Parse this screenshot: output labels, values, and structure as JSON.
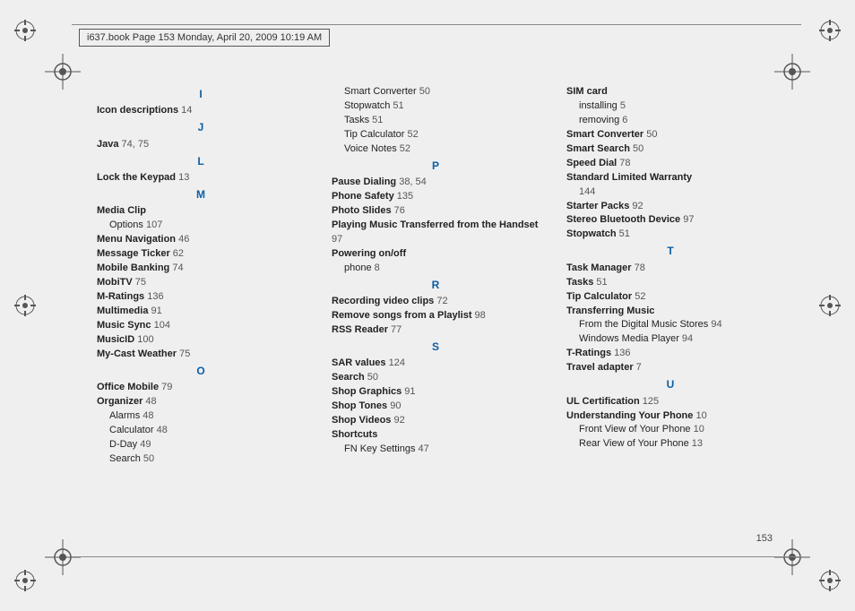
{
  "header": "i637.book  Page 153  Monday, April 20, 2009  10:19 AM",
  "page_number": "153",
  "columns": [
    {
      "items": [
        {
          "type": "letter",
          "text": "I"
        },
        {
          "type": "entry",
          "bold": "Icon descriptions",
          "page": "14"
        },
        {
          "type": "letter",
          "text": "J"
        },
        {
          "type": "entry",
          "bold": "Java",
          "page": "74, 75"
        },
        {
          "type": "letter",
          "text": "L"
        },
        {
          "type": "entry",
          "bold": "Lock the Keypad",
          "page": "13"
        },
        {
          "type": "letter",
          "text": "M"
        },
        {
          "type": "entry",
          "bold": "Media Clip"
        },
        {
          "type": "sub",
          "text": "Options",
          "page": "107"
        },
        {
          "type": "entry",
          "bold": "Menu Navigation",
          "page": "46"
        },
        {
          "type": "entry",
          "bold": "Message Ticker",
          "page": "62"
        },
        {
          "type": "entry",
          "bold": "Mobile Banking",
          "page": "74"
        },
        {
          "type": "entry",
          "bold": "MobiTV",
          "page": "75"
        },
        {
          "type": "entry",
          "bold": "M-Ratings",
          "page": "136"
        },
        {
          "type": "entry",
          "bold": "Multimedia",
          "page": "91"
        },
        {
          "type": "entry",
          "bold": "Music Sync",
          "page": "104"
        },
        {
          "type": "entry",
          "bold": "MusicID",
          "page": "100"
        },
        {
          "type": "entry",
          "bold": "My-Cast Weather",
          "page": "75"
        },
        {
          "type": "letter",
          "text": "O"
        },
        {
          "type": "entry",
          "bold": "Office Mobile",
          "page": "79"
        },
        {
          "type": "entry",
          "bold": "Organizer",
          "page": "48"
        },
        {
          "type": "sub",
          "text": "Alarms",
          "page": "48"
        },
        {
          "type": "sub",
          "text": "Calculator",
          "page": "48"
        },
        {
          "type": "sub",
          "text": "D-Day",
          "page": "49"
        },
        {
          "type": "sub",
          "text": "Search",
          "page": "50"
        }
      ]
    },
    {
      "items": [
        {
          "type": "sub",
          "text": "Smart Converter",
          "page": "50"
        },
        {
          "type": "sub",
          "text": "Stopwatch",
          "page": "51"
        },
        {
          "type": "sub",
          "text": "Tasks",
          "page": "51"
        },
        {
          "type": "sub",
          "text": "Tip Calculator",
          "page": "52"
        },
        {
          "type": "sub",
          "text": "Voice Notes",
          "page": "52"
        },
        {
          "type": "letter",
          "text": "P"
        },
        {
          "type": "entry",
          "bold": "Pause Dialing",
          "page": "38, 54"
        },
        {
          "type": "entry",
          "bold": "Phone Safety",
          "page": "135"
        },
        {
          "type": "entry",
          "bold": "Photo Slides",
          "page": "76"
        },
        {
          "type": "entry",
          "bold": "Playing Music Transferred from the Handset",
          "page": "97"
        },
        {
          "type": "entry",
          "bold": "Powering on/off"
        },
        {
          "type": "sub",
          "text": "phone",
          "page": "8"
        },
        {
          "type": "letter",
          "text": "R"
        },
        {
          "type": "entry",
          "bold": "Recording video clips",
          "page": "72"
        },
        {
          "type": "entry",
          "bold": "Remove songs from a Playlist",
          "page": "98"
        },
        {
          "type": "entry",
          "bold": "RSS Reader",
          "page": "77"
        },
        {
          "type": "letter",
          "text": "S"
        },
        {
          "type": "entry",
          "bold": "SAR values",
          "page": "124"
        },
        {
          "type": "entry",
          "bold": "Search",
          "page": "50"
        },
        {
          "type": "entry",
          "bold": "Shop Graphics",
          "page": "91"
        },
        {
          "type": "entry",
          "bold": "Shop Tones",
          "page": "90"
        },
        {
          "type": "entry",
          "bold": "Shop Videos",
          "page": "92"
        },
        {
          "type": "entry",
          "bold": "Shortcuts"
        },
        {
          "type": "sub",
          "text": "FN Key Settings",
          "page": "47"
        }
      ]
    },
    {
      "items": [
        {
          "type": "entry",
          "bold": "SIM card"
        },
        {
          "type": "sub",
          "text": "installing",
          "page": "5"
        },
        {
          "type": "sub",
          "text": "removing",
          "page": "6"
        },
        {
          "type": "entry",
          "bold": "Smart Converter",
          "page": "50"
        },
        {
          "type": "entry",
          "bold": "Smart Search",
          "page": "50"
        },
        {
          "type": "entry",
          "bold": "Speed Dial",
          "page": "78"
        },
        {
          "type": "entry",
          "bold": "Standard Limited Warranty",
          "page": "144",
          "pageOnNewLine": true
        },
        {
          "type": "entry",
          "bold": "Starter Packs",
          "page": "92"
        },
        {
          "type": "entry",
          "bold": "Stereo Bluetooth Device",
          "page": "97"
        },
        {
          "type": "entry",
          "bold": "Stopwatch",
          "page": "51"
        },
        {
          "type": "letter",
          "text": "T"
        },
        {
          "type": "entry",
          "bold": "Task Manager",
          "page": "78"
        },
        {
          "type": "entry",
          "bold": "Tasks",
          "page": "51"
        },
        {
          "type": "entry",
          "bold": "Tip Calculator",
          "page": "52"
        },
        {
          "type": "entry",
          "bold": "Transferring Music"
        },
        {
          "type": "sub",
          "text": "From the Digital Music Stores",
          "page": "94"
        },
        {
          "type": "sub",
          "text": "Windows Media Player",
          "page": "94"
        },
        {
          "type": "entry",
          "bold": "T-Ratings",
          "page": "136"
        },
        {
          "type": "entry",
          "bold": "Travel adapter",
          "page": "7"
        },
        {
          "type": "letter",
          "text": "U"
        },
        {
          "type": "entry",
          "bold": "UL Certification",
          "page": "125"
        },
        {
          "type": "entry",
          "bold": "Understanding Your Phone",
          "page": "10"
        },
        {
          "type": "sub",
          "text": "Front View of Your Phone",
          "page": "10"
        },
        {
          "type": "sub",
          "text": "Rear View of Your Phone",
          "page": "13"
        }
      ]
    }
  ]
}
